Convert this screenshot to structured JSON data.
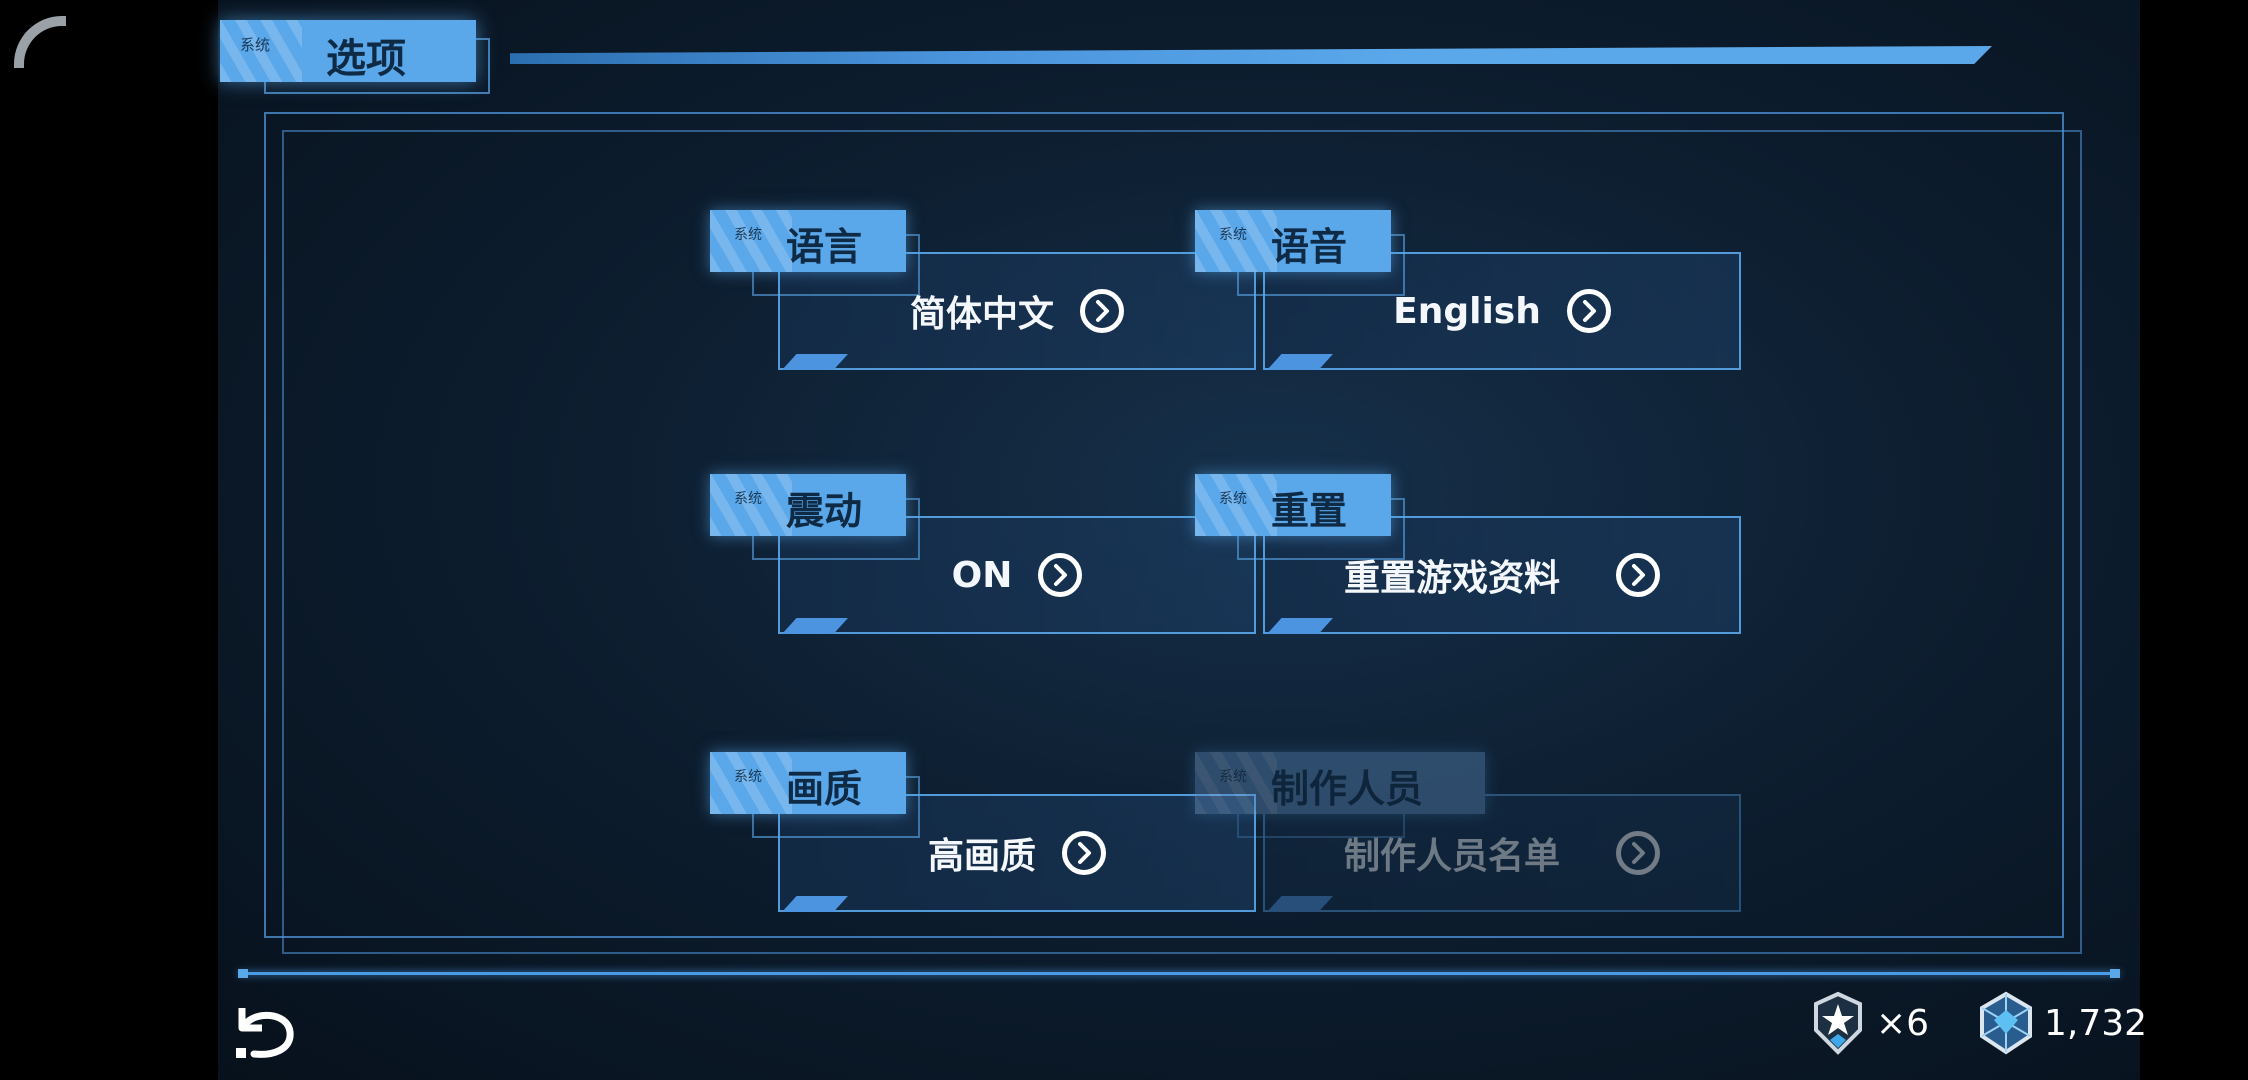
{
  "header": {
    "tab_small": "系统",
    "title": "选项"
  },
  "options": [
    {
      "key": "language",
      "category": "系统",
      "label": "语言",
      "value": "简体中文",
      "enabled": true
    },
    {
      "key": "voice",
      "category": "系统",
      "label": "语音",
      "value": "English",
      "enabled": true
    },
    {
      "key": "vibration",
      "category": "系统",
      "label": "震动",
      "value": "ON",
      "enabled": true
    },
    {
      "key": "reset",
      "category": "系统",
      "label": "重置",
      "value": "重置游戏资料",
      "enabled": true
    },
    {
      "key": "quality",
      "category": "系统",
      "label": "画质",
      "value": "高画质",
      "enabled": true
    },
    {
      "key": "credits",
      "category": "系统",
      "label": "制作人员",
      "value": "制作人员名单",
      "enabled": false
    }
  ],
  "resources": {
    "star_count": "×6",
    "crystal_count": "1,732"
  },
  "colors": {
    "accent": "#5aa7ea",
    "background": "#0d1e30"
  },
  "icons": [
    "corner-arc-icon",
    "chevron-right-icon",
    "back-icon",
    "star-badge-icon",
    "crystal-icon"
  ]
}
